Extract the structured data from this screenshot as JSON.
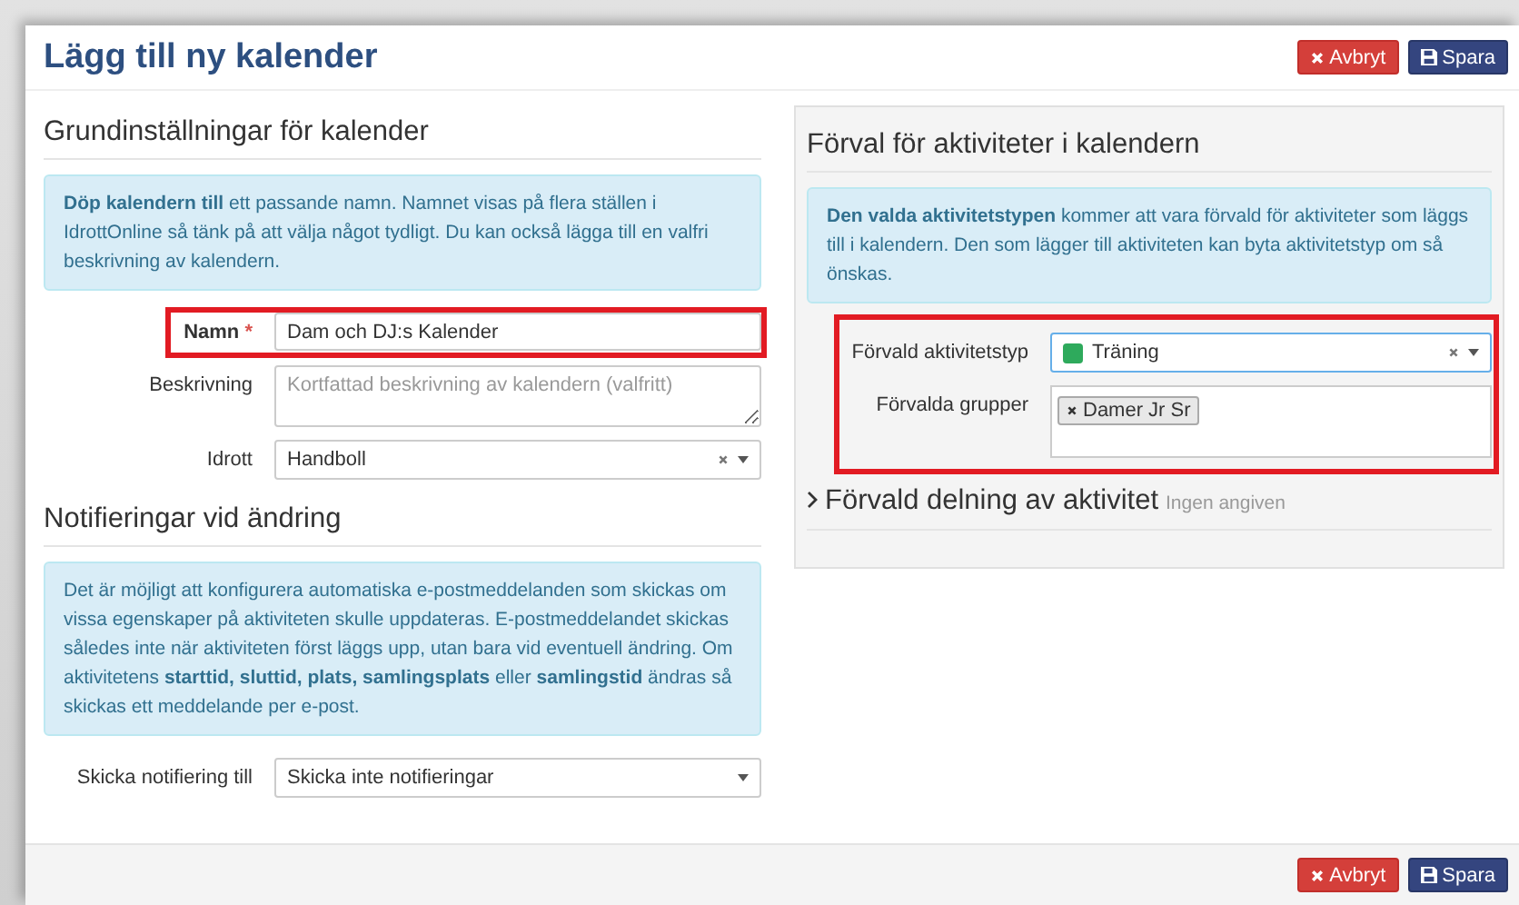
{
  "dialog": {
    "title": "Lägg till ny kalender",
    "header_buttons": [
      {
        "kind": "cancel",
        "label": "Avbryt"
      },
      {
        "kind": "save",
        "label": "Spara"
      }
    ],
    "basic_settings": {
      "heading": "Grundinställningar för kalender",
      "info": "**Döp kalendern till** ett passande namn. Namnet visas på flera ställen i IdrottOnline så tänk på att välja något tydligt. Du kan också lägga till en valfri beskrivning av kalendern.",
      "fields": [
        {
          "kind": "text",
          "label": "Namn",
          "required_mark": "*",
          "highlighted": true,
          "value": "Dam och DJ:s Kalender"
        },
        {
          "kind": "textarea",
          "label": "Beskrivning",
          "highlighted": false,
          "placeholder": "Kortfattad beskrivning av kalendern (valfritt)"
        },
        {
          "kind": "select",
          "label": "Idrott",
          "highlighted": false,
          "value": "Handboll"
        }
      ]
    },
    "notifications": {
      "heading": "Notifieringar vid ändring",
      "info": "Det är möjligt att konfigurera automatiska e-postmeddelanden som skickas om vissa egenskaper på aktiviteten skulle uppdateras. E-postmeddelandet skickas således inte när aktiviteten först läggs upp, utan bara vid eventuell ändring. Om aktivitetens **starttid, sluttid, plats, samlingsplats** eller **samlingstid** ändras så skickas ett meddelande per e-post.",
      "fields": [
        {
          "kind": "native-select",
          "label": "Skicka notifiering till",
          "highlighted": false,
          "value": "Skicka inte notifieringar"
        }
      ]
    },
    "activity_defaults": {
      "heading": "Förval för aktiviteter i kalendern",
      "info": "**Den valda aktivitetstypen** kommer att vara förvald för aktiviteter som läggs till i kalendern. Den som lägger till aktiviteten kan byta aktivitetstyp om så önskas.",
      "highlighted": true,
      "fields": [
        {
          "kind": "color-select",
          "label": "Förvald aktivitetstyp",
          "value": "Träning",
          "color": "#2eaa5c"
        },
        {
          "kind": "tags",
          "label": "Förvalda grupper",
          "tags": [
            "Damer Jr Sr"
          ]
        }
      ],
      "sharing": {
        "title": "Förvald delning av aktivitet",
        "status": "Ingen angiven",
        "expanded": false
      }
    },
    "footer_buttons": [
      {
        "kind": "cancel",
        "label": "Avbryt"
      },
      {
        "kind": "save",
        "label": "Spara"
      }
    ]
  }
}
